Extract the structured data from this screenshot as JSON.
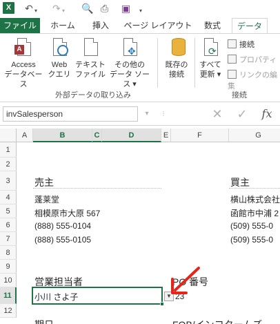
{
  "quick_access": {
    "app_badge": "X"
  },
  "ribbon_tabs": {
    "file": "ファイル",
    "home": "ホーム",
    "insert": "挿入",
    "page_layout": "ページ レイアウト",
    "formulas": "数式",
    "data": "データ"
  },
  "ribbon": {
    "access": [
      "Access",
      "データベース"
    ],
    "web": [
      "Web",
      "クエリ"
    ],
    "text": [
      "テキスト",
      "ファイル"
    ],
    "other": [
      "その他の",
      "データ ソース ▾"
    ],
    "existing": [
      "既存の",
      "接続"
    ],
    "refresh": [
      "すべて",
      "更新 ▾"
    ],
    "group_external": "外部データの取り込み",
    "conn_connect": "接続",
    "conn_properties": "プロパティ",
    "conn_edit_links": "リンクの編集",
    "group_connections": "接続"
  },
  "formula_bar": {
    "name_box": "invSalesperson",
    "cancel": "✕",
    "enter": "✓",
    "fx": "fx"
  },
  "columns": [
    "A",
    "B",
    "C",
    "D",
    "E",
    "F",
    "G"
  ],
  "rows": [
    "1",
    "2",
    "3",
    "4",
    "5",
    "6",
    "7",
    "8",
    "9",
    "10",
    "11",
    "12"
  ],
  "sheet": {
    "seller_header": "売主",
    "seller_name": "蓬莱堂",
    "seller_address": "相模原市大原 567",
    "seller_phone": "(888) 555-0104",
    "seller_fax": "(888) 555-0105",
    "buyer_header": "買主",
    "buyer_name": "横山株式会社",
    "buyer_address": "函館市中浦 2",
    "buyer_phone": "(509) 555-0",
    "buyer_fax": "(509) 555-0",
    "salesperson_label": "営業担当者",
    "salesperson_value": "小川 さよ子",
    "po_label": "PO 番号",
    "po_value": "23",
    "date_label": "期日",
    "fob_label": "FOB/インコタームズ"
  }
}
